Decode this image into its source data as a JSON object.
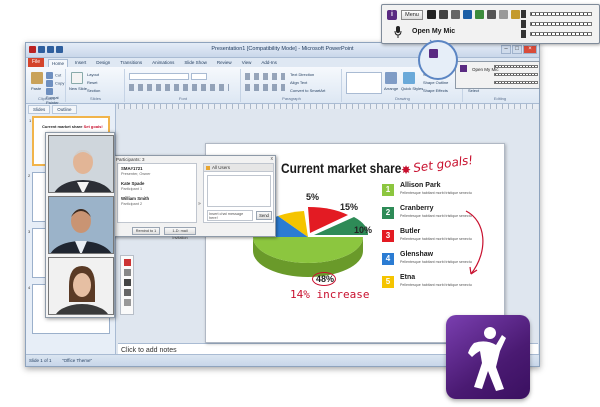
{
  "window": {
    "title": "Presentation1 [Compatibility Mode] - Microsoft PowerPoint",
    "file_tab": "File",
    "tabs": [
      "Home",
      "Insert",
      "Design",
      "Transitions",
      "Animations",
      "Slide Show",
      "Review",
      "View",
      "Add-Ins"
    ],
    "ribbon_groups": [
      "Clipboard",
      "Slides",
      "Font",
      "Paragraph",
      "Drawing",
      "Editing"
    ],
    "ribbon_buttons": {
      "paste": "Paste",
      "layout": "Layout",
      "reset": "Reset",
      "section": "Section",
      "new_slide": "New Slide",
      "cut": "Cut",
      "copy": "Copy",
      "format_painter": "Format Painter",
      "arrange": "Arrange",
      "quick_styles": "Quick Styles",
      "shape_fill": "Shape Fill",
      "shape_outline": "Shape Outline",
      "shape_effects": "Shape Effects",
      "find": "Find",
      "replace": "Replace",
      "select": "Select",
      "text_direction": "Text Direction",
      "align_text": "Align Text",
      "convert_smartart": "Convert to SmartArt"
    }
  },
  "left_panel": {
    "tabs": [
      "Slides",
      "Outline"
    ],
    "slide_numbers": [
      "1",
      "2",
      "3",
      "4",
      "5"
    ],
    "thumb_title": "Current market share",
    "thumb_annot": "Set goals!"
  },
  "status": {
    "slide": "Slide 1 of 1",
    "theme": "\"Office Theme\""
  },
  "notes_placeholder": "Click to add notes",
  "slide": {
    "title": "Current market share",
    "annotation": "Set goals!",
    "burst": "✸",
    "pie_labels": [
      "5%",
      "15%",
      "10%",
      "48%"
    ],
    "increase": "14% increase",
    "legend": [
      {
        "num": "1",
        "name": "Allison Park",
        "color": "#8cc63f"
      },
      {
        "num": "2",
        "name": "Cranberry",
        "color": "#2e8b57"
      },
      {
        "num": "3",
        "name": "Butler",
        "color": "#e31b23"
      },
      {
        "num": "4",
        "name": "Glenshaw",
        "color": "#2b7cd3"
      },
      {
        "num": "5",
        "name": "Etna",
        "color": "#f5c400"
      }
    ],
    "legend_desc": "Pellentesque habitant morbi tristique senectus et netus et malesuada fames ac turpis egestas."
  },
  "participants": {
    "header": "Participants: 3",
    "close": "x",
    "rows": [
      {
        "name": "SMA#1721",
        "role": "Presenter, Owner"
      },
      {
        "name": "Kate Spade",
        "role": "Participant 1"
      },
      {
        "name": "William Smith",
        "role": "Participant 2"
      }
    ],
    "chat_header": "All Users",
    "input_placeholder": "Insert chat message here!",
    "send": "Send",
    "btn_left": "Remind to 1",
    "btn_right": "1-D: mail Invitation"
  },
  "voice_toolbar": {
    "logo_letter": "i",
    "menu": "Menu",
    "open_mic": "Open My Mic",
    "mini_open_mic": "Open My Mic"
  },
  "colors": {
    "accent_purple": "#5a2a82",
    "powerpoint_red": "#d4442b",
    "annotation_red": "#c8102e"
  }
}
